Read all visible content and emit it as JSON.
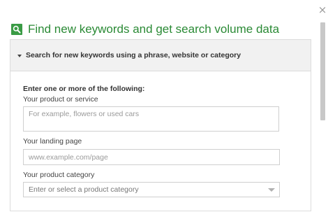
{
  "dialog": {
    "close_glyph": "×",
    "title": "Find new keywords and get search volume data",
    "title_icon": "search-icon",
    "accent_color": "#2a8a35"
  },
  "panel": {
    "header_label": "Search for new keywords using a phrase, website or category",
    "intro": "Enter one or more of the following:",
    "fields": {
      "product": {
        "label": "Your product or service",
        "value": "",
        "placeholder": "For example, flowers or used cars"
      },
      "landing": {
        "label": "Your landing page",
        "value": "",
        "placeholder": "www.example.com/page"
      },
      "category": {
        "label": "Your product category",
        "selected": "Enter or select a product category"
      }
    }
  }
}
